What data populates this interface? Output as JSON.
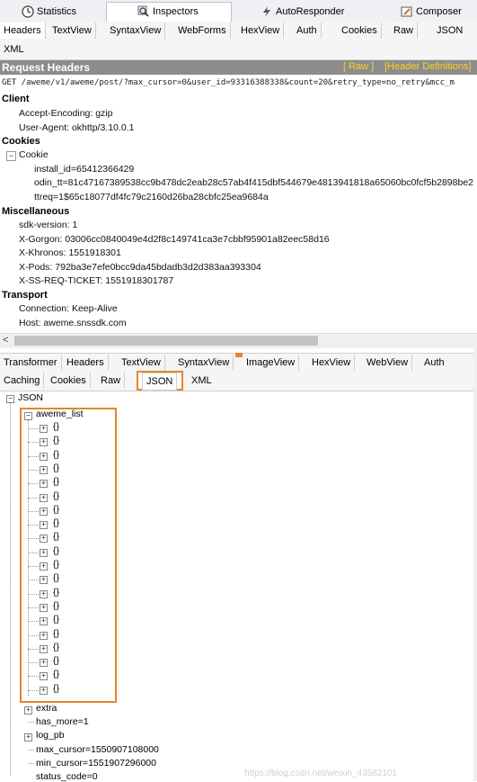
{
  "top_tabs": [
    {
      "label": "Statistics",
      "icon": "clock-icon"
    },
    {
      "label": "Inspectors",
      "icon": "magnifier-icon"
    },
    {
      "label": "AutoResponder",
      "icon": "lightning-icon"
    },
    {
      "label": "Composer",
      "icon": "pencil-icon"
    }
  ],
  "request_tabs": [
    "Headers",
    "TextView",
    "SyntaxView",
    "WebForms",
    "HexView",
    "Auth",
    "Cookies",
    "Raw",
    "JSON",
    "XML"
  ],
  "request_headers": {
    "title": "Request Headers",
    "raw_link": "[ Raw ]",
    "defs_link": "[Header Definitions]",
    "request_line": "GET /aweme/v1/aweme/post/?max_cursor=0&user_id=93316388338&count=20&retry_type=no_retry&mcc_m",
    "sections": {
      "client": {
        "title": "Client",
        "items": [
          "Accept-Encoding: gzip",
          "User-Agent: okhttp/3.10.0.1"
        ]
      },
      "cookies": {
        "title": "Cookies",
        "cookie_label": "Cookie",
        "items": [
          "install_id=65412366429",
          "odin_tt=81c47167389538cc9b478dc2eab28c57ab4f415dbf544679e4813941818a65060bc0fcf5b2898be2",
          "ttreq=1$65c18077df4fc79c2160d26ba28cbfc25ea9684a"
        ]
      },
      "misc": {
        "title": "Miscellaneous",
        "items": [
          "sdk-version: 1",
          "X-Gorgon: 03006cc0840049e4d2f8c149741ca3e7cbbf95901a82eec58d16",
          "X-Khronos: 1551918301",
          "X-Pods: 792ba3e7efe0bcc9da45bdadb3d2d383aa393304",
          "X-SS-REQ-TICKET: 1551918301787"
        ]
      },
      "transport": {
        "title": "Transport",
        "items": [
          "Connection: Keep-Alive",
          "Host: aweme.snssdk.com"
        ]
      }
    }
  },
  "response_tabs_row1": [
    "Transformer",
    "Headers",
    "TextView",
    "SyntaxView",
    "ImageView",
    "HexView",
    "WebView",
    "Auth"
  ],
  "response_tabs_row2": [
    "Caching",
    "Cookies",
    "Raw",
    "JSON",
    "XML"
  ],
  "json_tree": {
    "root": "JSON",
    "list_label": "aweme_list",
    "list_item": "{}",
    "list_count": 20,
    "after": [
      "extra",
      "has_more=1",
      "log_pb",
      "max_cursor=1550907108000",
      "min_cursor=1551907296000",
      "status_code=0"
    ]
  },
  "watermark": "https://blog.csdn.net/weixin_43582101",
  "colors": {
    "highlight_box": "#e6852c",
    "header_bar": "#8c8c8c",
    "header_links": "#f5d21f"
  }
}
